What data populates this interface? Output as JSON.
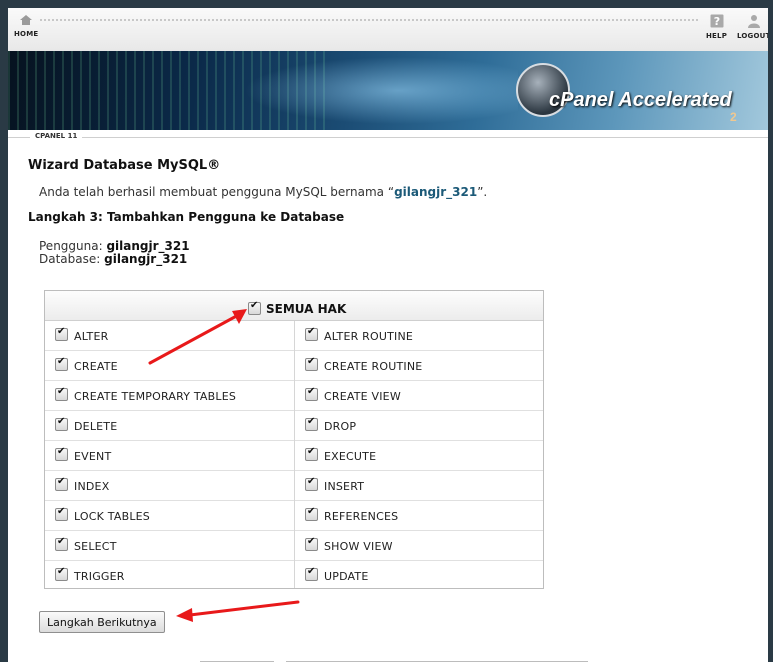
{
  "topbar": {
    "home_label": "HOME",
    "help_label": "HELP",
    "logout_label": "LOGOUT"
  },
  "banner": {
    "brand": "cPanel Accelerated",
    "brand_sub": "2"
  },
  "section_label": "CPANEL 11",
  "page": {
    "title": "Wizard Database MySQL®",
    "success_prefix": "Anda telah berhasil membuat pengguna MySQL bernama “",
    "success_user": "gilangjr_321",
    "success_suffix": "”.",
    "step_title": "Langkah 3: Tambahkan Pengguna ke Database",
    "user_label": "Pengguna:",
    "user_value": "gilangjr_321",
    "db_label": "Database:",
    "db_value": "gilangjr_321"
  },
  "privileges": {
    "all_label": "SEMUA HAK",
    "all_checked": true,
    "left": [
      {
        "label": "ALTER",
        "checked": true
      },
      {
        "label": "CREATE",
        "checked": true
      },
      {
        "label": "CREATE TEMPORARY TABLES",
        "checked": true
      },
      {
        "label": "DELETE",
        "checked": true
      },
      {
        "label": "EVENT",
        "checked": true
      },
      {
        "label": "INDEX",
        "checked": true
      },
      {
        "label": "LOCK TABLES",
        "checked": true
      },
      {
        "label": "SELECT",
        "checked": true
      },
      {
        "label": "TRIGGER",
        "checked": true
      }
    ],
    "right": [
      {
        "label": "ALTER ROUTINE",
        "checked": true
      },
      {
        "label": "CREATE ROUTINE",
        "checked": true
      },
      {
        "label": "CREATE VIEW",
        "checked": true
      },
      {
        "label": "DROP",
        "checked": true
      },
      {
        "label": "EXECUTE",
        "checked": true
      },
      {
        "label": "INSERT",
        "checked": true
      },
      {
        "label": "REFERENCES",
        "checked": true
      },
      {
        "label": "SHOW VIEW",
        "checked": true
      },
      {
        "label": "UPDATE",
        "checked": true
      }
    ]
  },
  "next_button_label": "Langkah Berikutnya",
  "colors": {
    "username_accent": "#1c5a78",
    "arrow": "#e8191a"
  }
}
